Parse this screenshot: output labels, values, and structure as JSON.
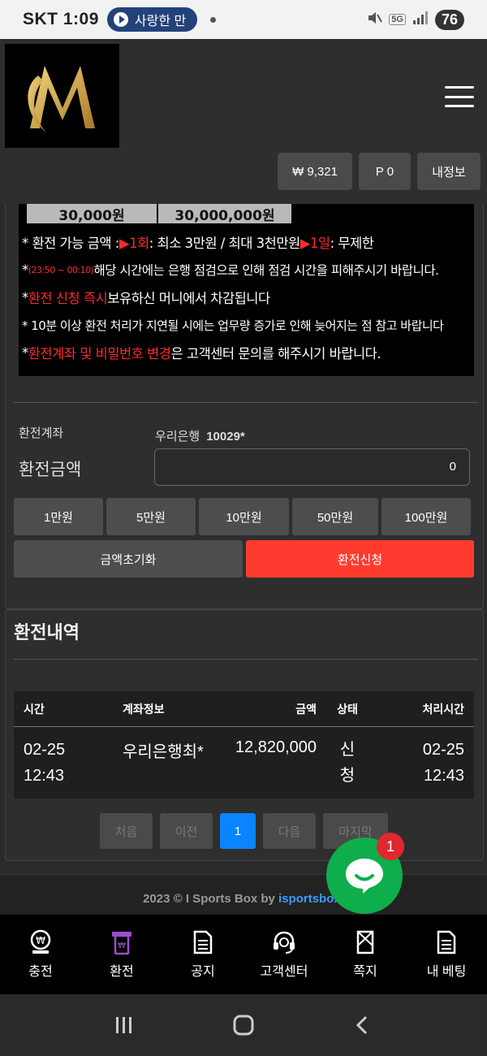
{
  "status_bar": {
    "carrier": "SKT",
    "time": "1:09",
    "media_pill": "사랑한 만",
    "network": "5G",
    "battery": "76"
  },
  "header": {
    "wallet_balance": "₩ 9,321",
    "points": "P 0",
    "my_info": "내정보"
  },
  "notice": {
    "amounts": [
      "30,000원",
      "30,000,000원"
    ],
    "lines": [
      {
        "a": "* 환전 가능 금액 : ",
        "b": "▶1회",
        "c": " : 최소 3만원 / 최대 3천만원 ",
        "d": "▶1일",
        "e": " : 무제한"
      },
      {
        "a": "* ",
        "b": "(23:50 ~ 00:10)",
        "c": " 해당 시간에는 은행 점검으로 인해 점검 시간을 피해주시기 바랍니다."
      },
      {
        "a": "* ",
        "b": "환전 신청 즉시",
        "c": " 보유하신 머니에서 차감됩니다"
      },
      {
        "a": "* 10분 이상 환전 처리가 지연될 시에는 업무량 증가로 인해 늦어지는 점 참고 바랍니다"
      },
      {
        "a": "* ",
        "b": "환전계좌 및 비밀번호 변경",
        "c": "은 고객센터 문의를 해주시기 바랍니다."
      }
    ]
  },
  "form": {
    "account_label": "환전계좌",
    "account_bank": "우리은행",
    "account_number": "10029*",
    "amount_label": "환전금액",
    "amount_value": "0",
    "quick_amounts": [
      "1만원",
      "5만원",
      "10만원",
      "50만원",
      "100만원"
    ],
    "reset_label": "금액초기화",
    "submit_label": "환전신청"
  },
  "history": {
    "title": "환전내역",
    "columns": [
      "시간",
      "계좌정보",
      "금액",
      "상태",
      "처리시간"
    ],
    "rows": [
      {
        "time": "02-25\n12:43",
        "account": "우리은행최*",
        "amount": "12,820,000",
        "status": "신\n청",
        "processed": "02-25\n12:43"
      }
    ],
    "pager": [
      "처음",
      "이전",
      "1",
      "다음",
      "마지막"
    ]
  },
  "footer": {
    "text": "2023 © I Sports Box by ",
    "link": "isportsbox."
  },
  "chat": {
    "badge": "1"
  },
  "bottom_nav": [
    {
      "label": "충전",
      "icon": "deposit-coin-icon"
    },
    {
      "label": "환전",
      "icon": "withdraw-icon"
    },
    {
      "label": "공지",
      "icon": "notice-document-icon"
    },
    {
      "label": "고객센터",
      "icon": "headset-icon"
    },
    {
      "label": "쪽지",
      "icon": "message-icon"
    },
    {
      "label": "내 베팅",
      "icon": "my-bet-document-icon"
    }
  ],
  "colors": {
    "accent_red": "#ff3b30",
    "active_blue": "#0a84ff",
    "chat_green": "#0fae4c",
    "notice_red": "#ff2a2a",
    "withdraw_nav_purple": "#9b4dcc"
  }
}
